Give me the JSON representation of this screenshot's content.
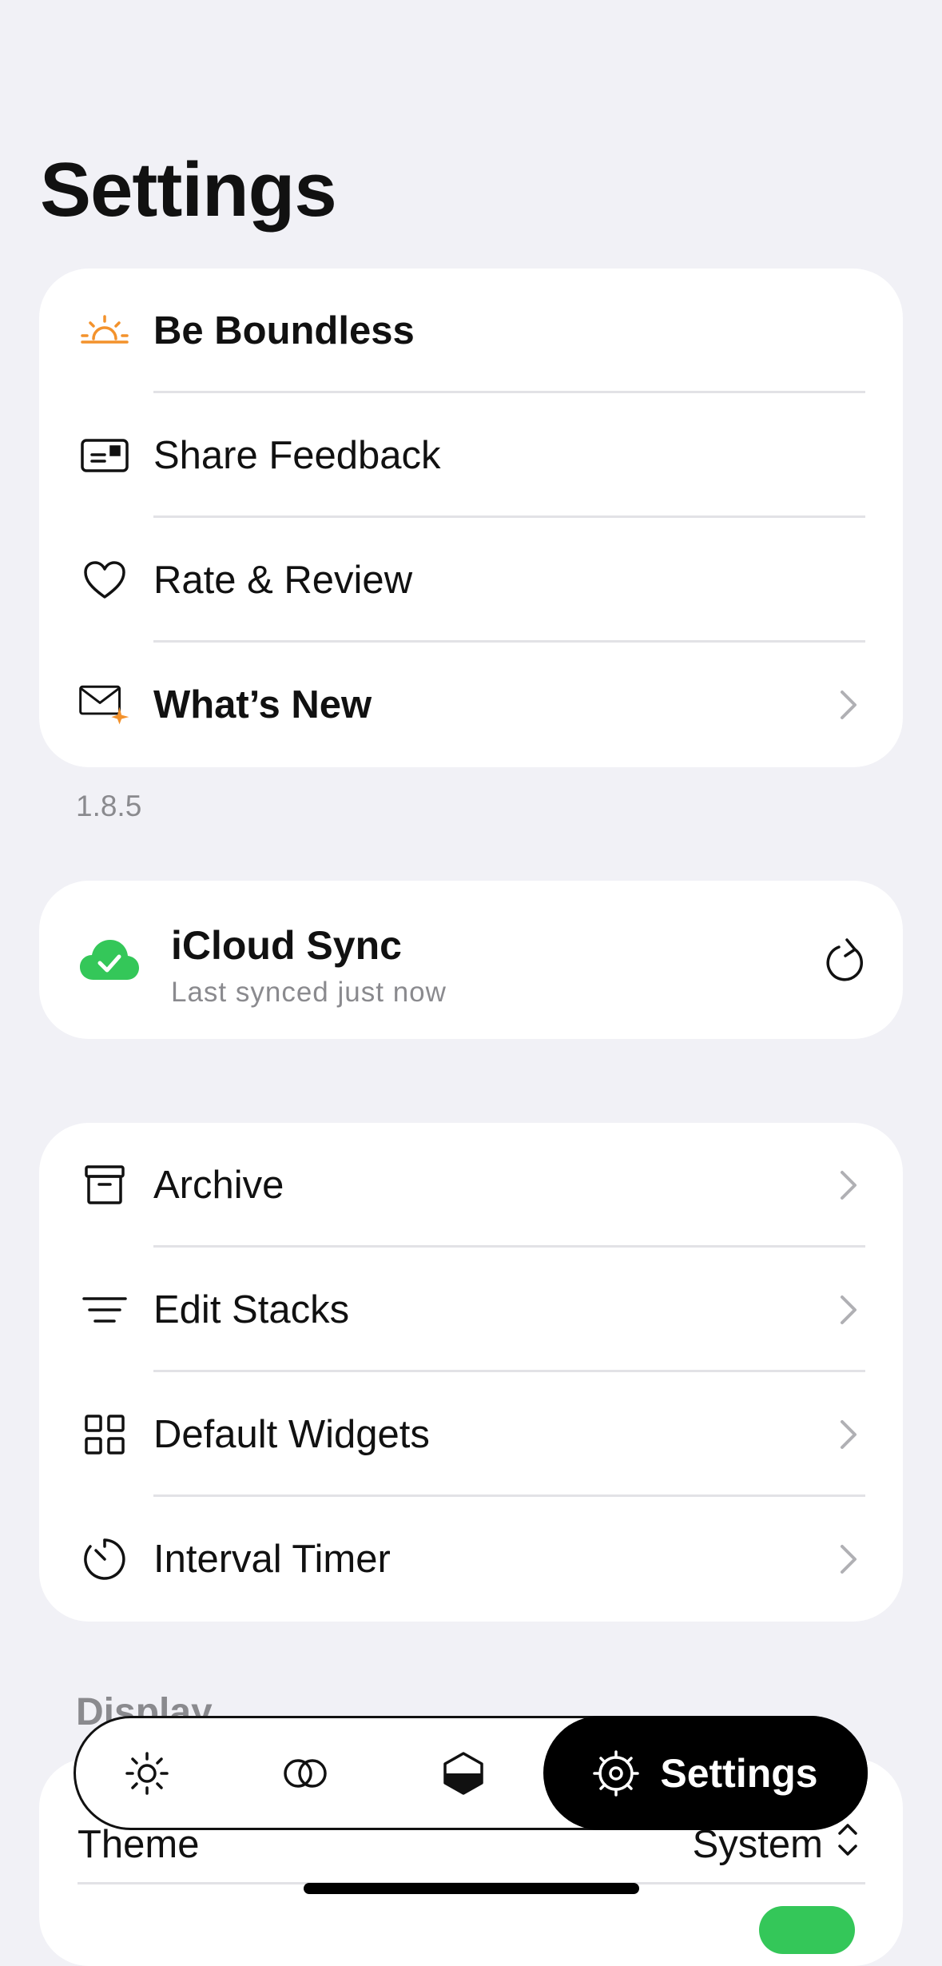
{
  "page": {
    "title": "Settings"
  },
  "group1": {
    "items": [
      {
        "label": "Be Boundless",
        "icon": "sunrise-icon"
      },
      {
        "label": "Share Feedback",
        "icon": "feedback-icon"
      },
      {
        "label": "Rate & Review",
        "icon": "heart-icon"
      },
      {
        "label": "What’s New",
        "icon": "mail-sparkle-icon"
      }
    ]
  },
  "version": "1.8.5",
  "sync": {
    "title": "iCloud Sync",
    "subtitle": "Last synced just now",
    "icon": "cloud-check-icon",
    "action_icon": "refresh-icon"
  },
  "group2": {
    "items": [
      {
        "label": "Archive",
        "icon": "archive-icon"
      },
      {
        "label": "Edit Stacks",
        "icon": "stacks-icon"
      },
      {
        "label": "Default Widgets",
        "icon": "widgets-icon"
      },
      {
        "label": "Interval Timer",
        "icon": "timer-icon"
      }
    ]
  },
  "display": {
    "header": "Display",
    "theme": {
      "label": "Theme",
      "value": "System"
    }
  },
  "tabbar": {
    "tabs": [
      {
        "icon": "sun-icon"
      },
      {
        "icon": "rings-icon"
      },
      {
        "icon": "half-hexagon-icon"
      },
      {
        "icon": "gear-icon",
        "label": "Settings",
        "active": true
      }
    ]
  },
  "colors": {
    "accent_orange": "#F3922C",
    "sync_green": "#34C759",
    "background": "#F1F1F6"
  }
}
